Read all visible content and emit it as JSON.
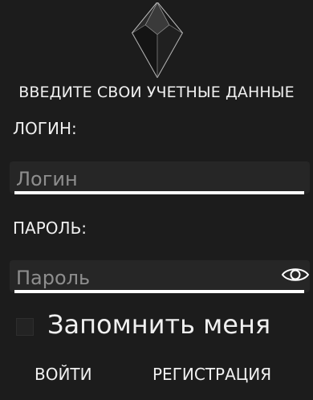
{
  "header": {
    "logo_icon": "crystal-logo-icon",
    "heading": "ВВЕДИТЕ СВОИ УЧЕТНЫЕ ДАННЫЕ"
  },
  "login": {
    "label": "ЛОГИН:",
    "placeholder": "Логин",
    "value": ""
  },
  "password": {
    "label": "ПАРОЛЬ:",
    "placeholder": "Пароль",
    "value": "",
    "toggle_icon": "eye-icon"
  },
  "remember": {
    "label": "Запомнить меня",
    "checked": false
  },
  "actions": {
    "login_label": "ВОЙТИ",
    "register_label": "РЕГИСТРАЦИЯ"
  },
  "colors": {
    "background": "#1c1c1c",
    "field_background": "#262626",
    "text": "#f0f0f0",
    "placeholder": "#8e8e8e",
    "underline": "#ffffff"
  }
}
